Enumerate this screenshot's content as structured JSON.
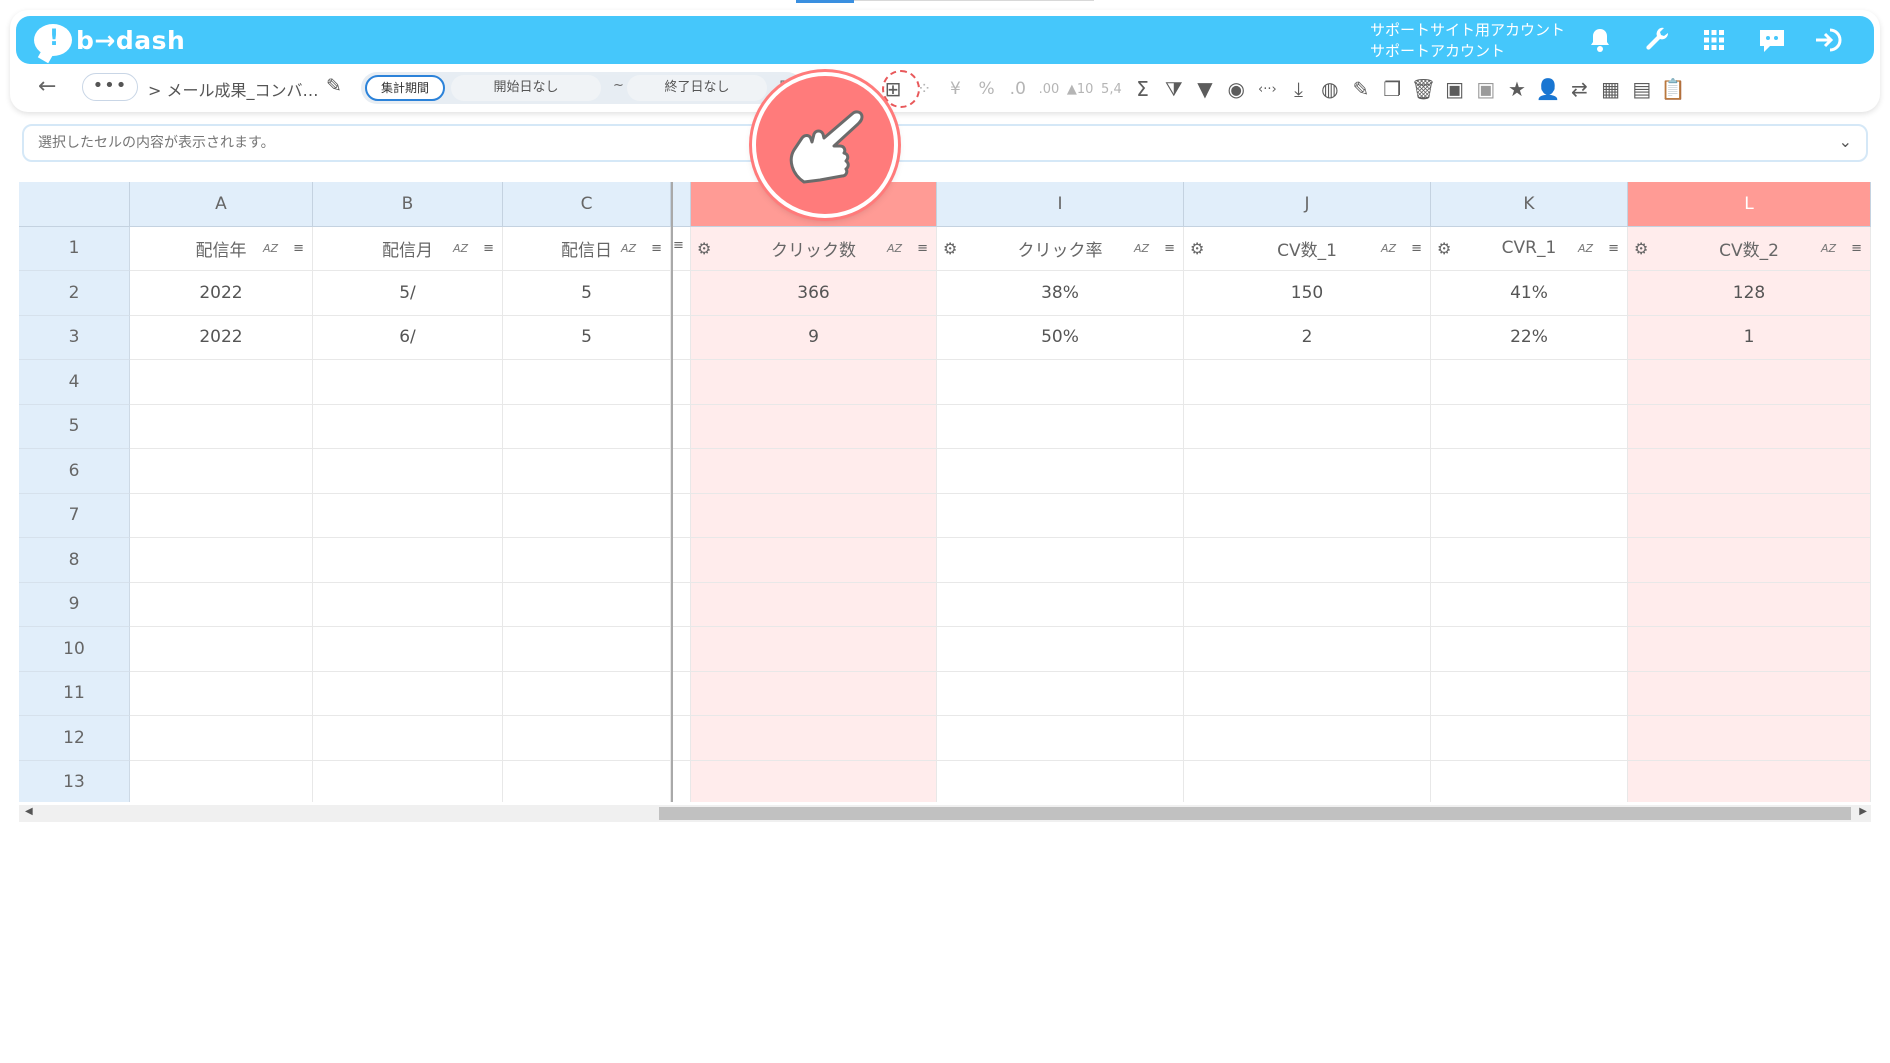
{
  "app": {
    "logo_text": "b→dash",
    "logo_mark": "!",
    "account_line1": "サポートサイト用アカウント",
    "account_line2": "サポートアカウント"
  },
  "header_icons": [
    "bell-icon",
    "wrench-icon",
    "apps-grid-icon",
    "chat-robot-icon",
    "logout-icon"
  ],
  "toolbar": {
    "back": "←",
    "more": "•••",
    "breadcrumb": "> メール成果_コンバ…",
    "period_label": "集計期間",
    "start_date": "開始日なし",
    "tilde": "~",
    "end_date": "終了日なし"
  },
  "toolbar_icons": [
    {
      "name": "table-layout-icon",
      "glyph": "⊞"
    },
    {
      "name": "loading-icon",
      "glyph": "⁘"
    },
    {
      "name": "yen-icon",
      "glyph": "¥"
    },
    {
      "name": "percent-icon",
      "glyph": "%"
    },
    {
      "name": "decimal-decrease-icon",
      "glyph": ".0"
    },
    {
      "name": "decimal-increase-icon",
      "glyph": ".00"
    },
    {
      "name": "number-format-icon",
      "glyph": "▲10"
    },
    {
      "name": "number-format-2-icon",
      "glyph": "5,4"
    },
    {
      "name": "sum-icon",
      "glyph": "Σ"
    },
    {
      "name": "filter-clear-icon",
      "glyph": "⧩"
    },
    {
      "name": "filter-icon",
      "glyph": "▼"
    },
    {
      "name": "eye-icon",
      "glyph": "◉"
    },
    {
      "name": "code-icon",
      "glyph": "‹··›"
    },
    {
      "name": "download-icon",
      "glyph": "⤓"
    },
    {
      "name": "chart-icon",
      "glyph": "◍"
    },
    {
      "name": "edit-icon",
      "glyph": "✎"
    },
    {
      "name": "copy-icon",
      "glyph": "❐"
    },
    {
      "name": "trash-icon",
      "glyph": "🗑"
    },
    {
      "name": "archive-icon",
      "glyph": "▣"
    },
    {
      "name": "archive-disabled-icon",
      "glyph": "▣"
    },
    {
      "name": "star-icon",
      "glyph": "★"
    },
    {
      "name": "user-check-icon",
      "glyph": "👤"
    },
    {
      "name": "repeat-icon",
      "glyph": "⇄"
    },
    {
      "name": "calendar-icon",
      "glyph": "▦"
    },
    {
      "name": "document-icon",
      "glyph": "▤"
    },
    {
      "name": "clipboard-icon",
      "glyph": "📋"
    }
  ],
  "formula_bar": {
    "placeholder": "選択したセルの内容が表示されます。"
  },
  "grid": {
    "columns": [
      {
        "letter": "A",
        "header": "配信年",
        "selected": false
      },
      {
        "letter": "B",
        "header": "配信月",
        "selected": false
      },
      {
        "letter": "C",
        "header": "配信日",
        "selected": false
      },
      {
        "letter": "",
        "header": "クリック数",
        "selected": true
      },
      {
        "letter": "I",
        "header": "クリック率",
        "selected": false
      },
      {
        "letter": "J",
        "header": "CV数_1",
        "selected": false
      },
      {
        "letter": "K",
        "header": "CVR_1",
        "selected": false
      },
      {
        "letter": "L",
        "header": "CV数_2",
        "selected": true
      }
    ],
    "sort_label": "AZ",
    "row_numbers": [
      "1",
      "2",
      "3",
      "4",
      "5",
      "6",
      "7",
      "8",
      "9",
      "10",
      "11",
      "12",
      "13"
    ],
    "rows": [
      [
        "2022",
        "5/",
        "5",
        "366",
        "38%",
        "150",
        "41%",
        "128"
      ],
      [
        "2022",
        "6/",
        "5",
        "9",
        "50%",
        "2",
        "22%",
        "1"
      ]
    ]
  },
  "colors": {
    "header_bg": "#45c7fb",
    "selected_col_header": "#ff9b95",
    "selected_col_cell": "#ffecec",
    "grid_header_bg": "#e1eefa"
  }
}
